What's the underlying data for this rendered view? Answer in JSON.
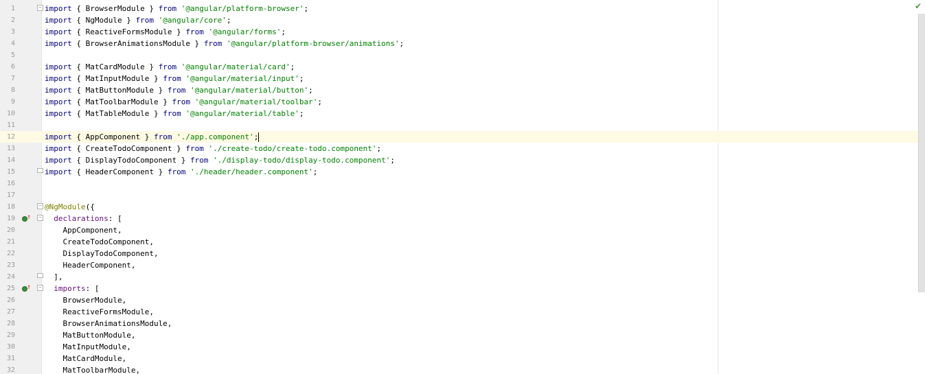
{
  "editor": {
    "status_icon": "checkmark-icon",
    "status_color": "#4a9a3a",
    "current_line": 12
  },
  "code_lines": [
    {
      "n": "1",
      "tokens": [
        [
          "kw",
          "import"
        ],
        [
          "t",
          " { BrowserModule } "
        ],
        [
          "kw",
          "from"
        ],
        [
          "t",
          " "
        ],
        [
          "str",
          "'@angular/platform-browser'"
        ],
        [
          "t",
          ";"
        ]
      ]
    },
    {
      "n": "2",
      "tokens": [
        [
          "kw",
          "import"
        ],
        [
          "t",
          " { NgModule } "
        ],
        [
          "kw",
          "from"
        ],
        [
          "t",
          " "
        ],
        [
          "str",
          "'@angular/core'"
        ],
        [
          "t",
          ";"
        ]
      ]
    },
    {
      "n": "3",
      "tokens": [
        [
          "kw",
          "import"
        ],
        [
          "t",
          " { ReactiveFormsModule } "
        ],
        [
          "kw",
          "from"
        ],
        [
          "t",
          " "
        ],
        [
          "str",
          "'@angular/forms'"
        ],
        [
          "t",
          ";"
        ]
      ]
    },
    {
      "n": "4",
      "tokens": [
        [
          "kw",
          "import"
        ],
        [
          "t",
          " { BrowserAnimationsModule } "
        ],
        [
          "kw",
          "from"
        ],
        [
          "t",
          " "
        ],
        [
          "str",
          "'@angular/platform-browser/animations'"
        ],
        [
          "t",
          ";"
        ]
      ]
    },
    {
      "n": "5",
      "tokens": []
    },
    {
      "n": "6",
      "tokens": [
        [
          "kw",
          "import"
        ],
        [
          "t",
          " { MatCardModule } "
        ],
        [
          "kw",
          "from"
        ],
        [
          "t",
          " "
        ],
        [
          "str",
          "'@angular/material/card'"
        ],
        [
          "t",
          ";"
        ]
      ]
    },
    {
      "n": "7",
      "tokens": [
        [
          "kw",
          "import"
        ],
        [
          "t",
          " { MatInputModule } "
        ],
        [
          "kw",
          "from"
        ],
        [
          "t",
          " "
        ],
        [
          "str",
          "'@angular/material/input'"
        ],
        [
          "t",
          ";"
        ]
      ]
    },
    {
      "n": "8",
      "tokens": [
        [
          "kw",
          "import"
        ],
        [
          "t",
          " { MatButtonModule } "
        ],
        [
          "kw",
          "from"
        ],
        [
          "t",
          " "
        ],
        [
          "str",
          "'@angular/material/button'"
        ],
        [
          "t",
          ";"
        ]
      ]
    },
    {
      "n": "9",
      "tokens": [
        [
          "kw",
          "import"
        ],
        [
          "t",
          " { MatToolbarModule } "
        ],
        [
          "kw",
          "from"
        ],
        [
          "t",
          " "
        ],
        [
          "str",
          "'@angular/material/toolbar'"
        ],
        [
          "t",
          ";"
        ]
      ]
    },
    {
      "n": "10",
      "tokens": [
        [
          "kw",
          "import"
        ],
        [
          "t",
          " { MatTableModule } "
        ],
        [
          "kw",
          "from"
        ],
        [
          "t",
          " "
        ],
        [
          "str",
          "'@angular/material/table'"
        ],
        [
          "t",
          ";"
        ]
      ]
    },
    {
      "n": "11",
      "tokens": []
    },
    {
      "n": "12",
      "tokens": [
        [
          "kw",
          "import"
        ],
        [
          "t",
          " { AppComponent } "
        ],
        [
          "kw",
          "from"
        ],
        [
          "t",
          " "
        ],
        [
          "str",
          "'./app.component'"
        ],
        [
          "t",
          ";"
        ]
      ]
    },
    {
      "n": "13",
      "tokens": [
        [
          "kw",
          "import"
        ],
        [
          "t",
          " { CreateTodoComponent } "
        ],
        [
          "kw",
          "from"
        ],
        [
          "t",
          " "
        ],
        [
          "str",
          "'./create-todo/create-todo.component'"
        ],
        [
          "t",
          ";"
        ]
      ]
    },
    {
      "n": "14",
      "tokens": [
        [
          "kw",
          "import"
        ],
        [
          "t",
          " { DisplayTodoComponent } "
        ],
        [
          "kw",
          "from"
        ],
        [
          "t",
          " "
        ],
        [
          "str",
          "'./display-todo/display-todo.component'"
        ],
        [
          "t",
          ";"
        ]
      ]
    },
    {
      "n": "15",
      "tokens": [
        [
          "kw",
          "import"
        ],
        [
          "t",
          " { HeaderComponent } "
        ],
        [
          "kw",
          "from"
        ],
        [
          "t",
          " "
        ],
        [
          "str",
          "'./header/header.component'"
        ],
        [
          "t",
          ";"
        ]
      ]
    },
    {
      "n": "16",
      "tokens": []
    },
    {
      "n": "17",
      "tokens": []
    },
    {
      "n": "18",
      "tokens": [
        [
          "deco",
          "@NgModule"
        ],
        [
          "t",
          "({"
        ]
      ]
    },
    {
      "n": "19",
      "tokens": [
        [
          "t",
          "  "
        ],
        [
          "prop",
          "declarations"
        ],
        [
          "t",
          ": ["
        ]
      ]
    },
    {
      "n": "20",
      "tokens": [
        [
          "t",
          "    AppComponent,"
        ]
      ]
    },
    {
      "n": "21",
      "tokens": [
        [
          "t",
          "    CreateTodoComponent,"
        ]
      ]
    },
    {
      "n": "22",
      "tokens": [
        [
          "t",
          "    DisplayTodoComponent,"
        ]
      ]
    },
    {
      "n": "23",
      "tokens": [
        [
          "t",
          "    HeaderComponent,"
        ]
      ]
    },
    {
      "n": "24",
      "tokens": [
        [
          "t",
          "  ],"
        ]
      ]
    },
    {
      "n": "25",
      "tokens": [
        [
          "t",
          "  "
        ],
        [
          "prop",
          "imports"
        ],
        [
          "t",
          ": ["
        ]
      ]
    },
    {
      "n": "26",
      "tokens": [
        [
          "t",
          "    BrowserModule,"
        ]
      ]
    },
    {
      "n": "27",
      "tokens": [
        [
          "t",
          "    ReactiveFormsModule,"
        ]
      ]
    },
    {
      "n": "28",
      "tokens": [
        [
          "t",
          "    BrowserAnimationsModule,"
        ]
      ]
    },
    {
      "n": "29",
      "tokens": [
        [
          "t",
          "    MatButtonModule,"
        ]
      ]
    },
    {
      "n": "30",
      "tokens": [
        [
          "t",
          "    MatInputModule,"
        ]
      ]
    },
    {
      "n": "31",
      "tokens": [
        [
          "t",
          "    MatCardModule,"
        ]
      ]
    },
    {
      "n": "32",
      "tokens": [
        [
          "t",
          "    MatToolbarModule,"
        ]
      ]
    }
  ],
  "fold_open_lines": [
    "1",
    "18",
    "19",
    "25"
  ],
  "fold_close_lines": [
    "15",
    "24"
  ],
  "implements_marker_lines": [
    "19",
    "25"
  ]
}
